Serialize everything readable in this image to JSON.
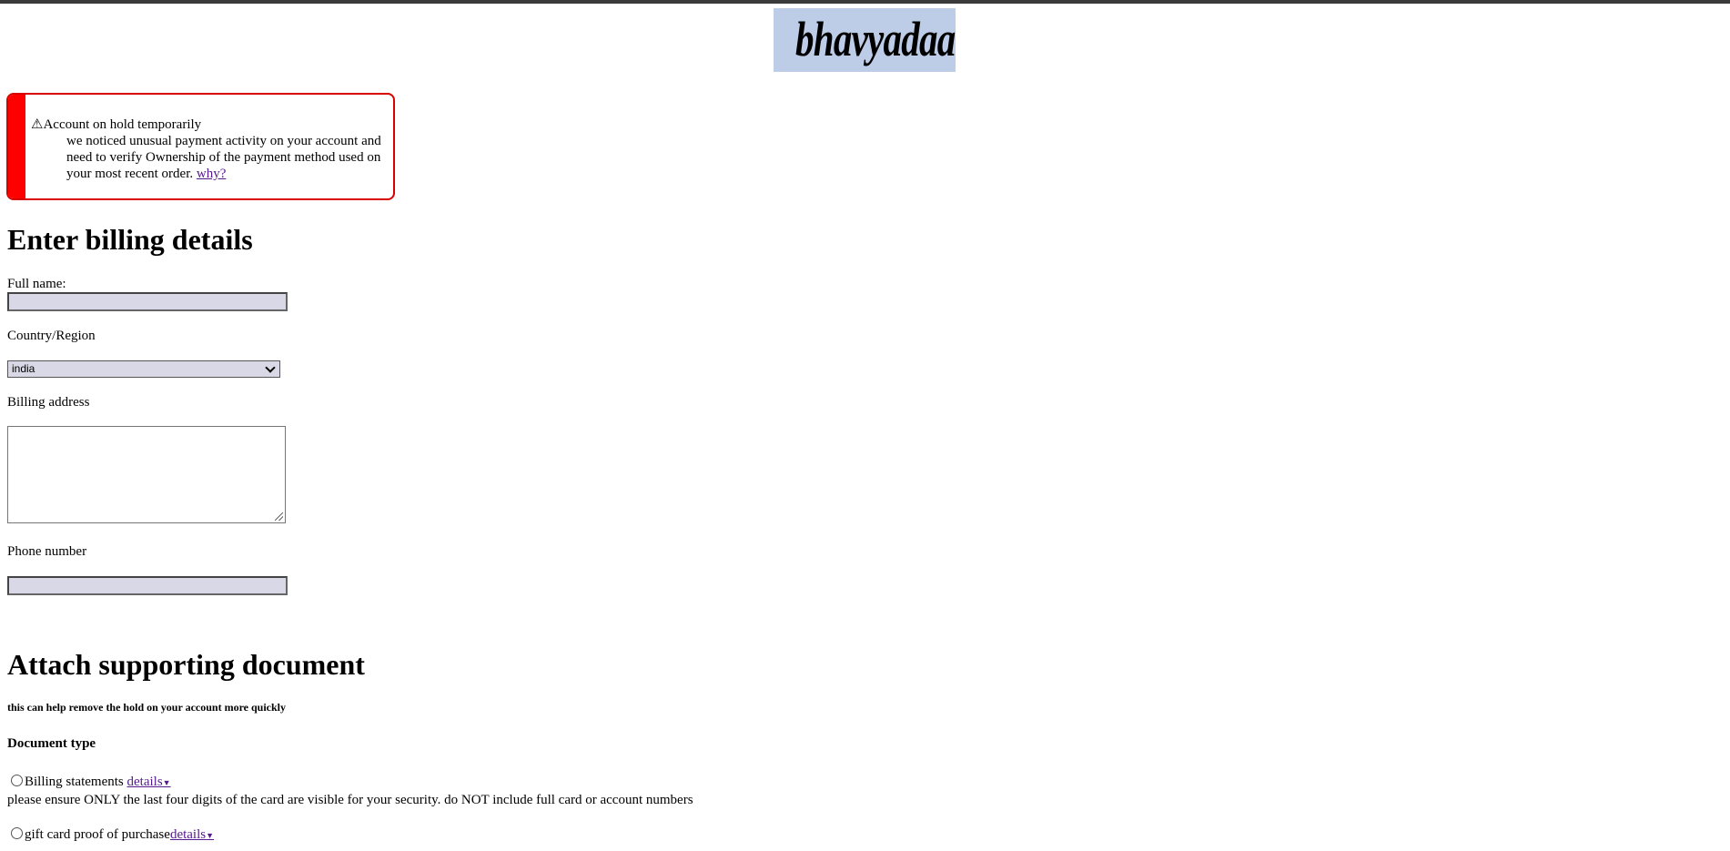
{
  "logo": {
    "text": "bhavyadaan"
  },
  "alert": {
    "icon": "warning-icon",
    "icon_glyph": "⚠",
    "title": "Account on hold temporarily",
    "body": "we noticed unusual payment activity on your account and need to verify Ownership of the payment method used on your most recent order.",
    "link": "why?",
    "accent_color": "#ff0000"
  },
  "billing": {
    "heading": "Enter billing details",
    "full_name_label": "Full name:",
    "full_name_value": "",
    "country_label": "Country/Region",
    "country_value": "india",
    "address_label": "Billing address",
    "address_value": "",
    "phone_label": "Phone number",
    "phone_value": ""
  },
  "documents": {
    "heading": "Attach supporting document",
    "subtitle": "this can help remove the hold on your account more quickly",
    "type_label": "Document type",
    "options": [
      {
        "label": "Billing statements ",
        "link": "details",
        "note": "please ensure ONLY the last four digits of the card are visible for your security. do NOT include full card or account numbers"
      },
      {
        "label": "gift card proof of purchase",
        "link": "details"
      }
    ],
    "dropdown_glyph": "▼"
  }
}
